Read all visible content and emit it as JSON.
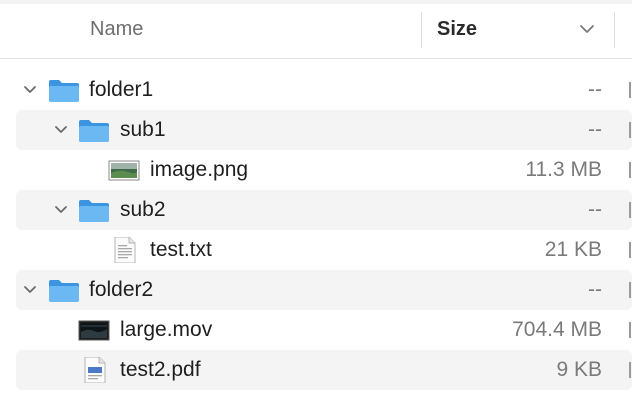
{
  "header": {
    "name_label": "Name",
    "size_label": "Size"
  },
  "rows": [
    {
      "label": "folder1",
      "size": "--",
      "type": "folder",
      "expanded": true
    },
    {
      "label": "sub1",
      "size": "--",
      "type": "folder",
      "expanded": true
    },
    {
      "label": "image.png",
      "size": "11.3 MB",
      "type": "image-file"
    },
    {
      "label": "sub2",
      "size": "--",
      "type": "folder",
      "expanded": true
    },
    {
      "label": "test.txt",
      "size": "21 KB",
      "type": "text-file"
    },
    {
      "label": "folder2",
      "size": "--",
      "type": "folder",
      "expanded": true
    },
    {
      "label": "large.mov",
      "size": "704.4 MB",
      "type": "movie-file"
    },
    {
      "label": "test2.pdf",
      "size": "9 KB",
      "type": "pdf-file"
    }
  ],
  "colors": {
    "folder_blue": "#58a9ea",
    "stripe": "#f4f4f4",
    "text": "#1f1f1f",
    "size_text": "#7a7a7a"
  }
}
